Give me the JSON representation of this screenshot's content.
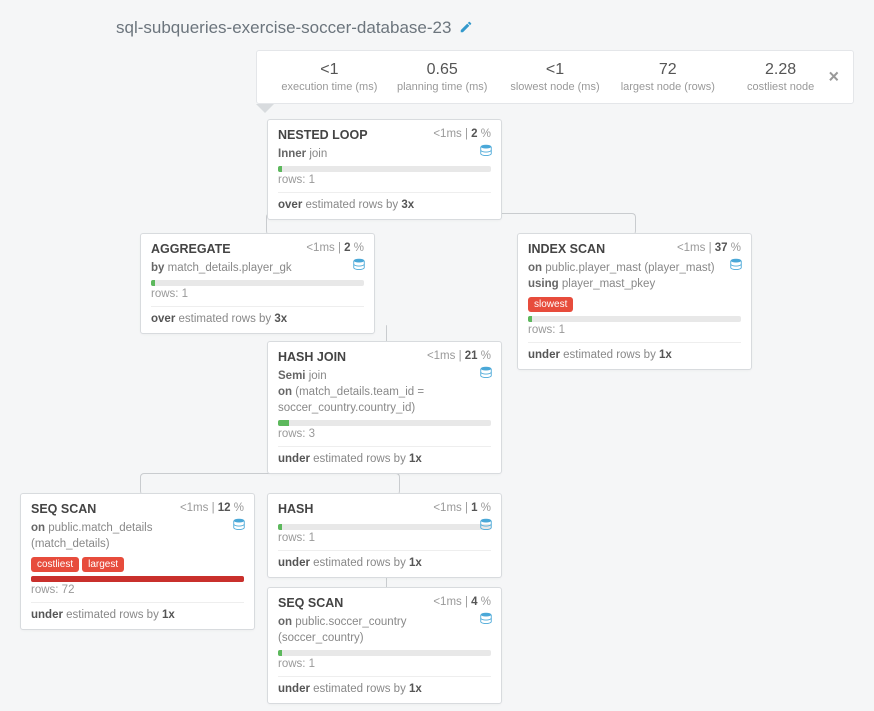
{
  "title": "sql-subqueries-exercise-soccer-database-23",
  "stats": {
    "exec_val": "<1",
    "exec_lbl": "execution time (ms)",
    "plan_val": "0.65",
    "plan_lbl": "planning time (ms)",
    "slow_val": "<1",
    "slow_lbl": "slowest node (ms)",
    "large_val": "72",
    "large_lbl": "largest node (rows)",
    "cost_val": "2.28",
    "cost_lbl": "costliest node"
  },
  "nodes": {
    "n0": {
      "title": "NESTED LOOP",
      "ms": "<1ms",
      "pct": "2",
      "desc_a": "Inner",
      "desc_b": " join",
      "bar_w": "2%",
      "bar_c": "bar-green",
      "rows": "1",
      "est_a": "over",
      "est_b": " estimated rows by ",
      "est_c": "3x"
    },
    "n1": {
      "title": "AGGREGATE",
      "ms": "<1ms",
      "pct": "2",
      "desc_a": "by",
      "desc_b": " match_details.player_gk",
      "bar_w": "2%",
      "bar_c": "bar-green",
      "rows": "1",
      "est_a": "over",
      "est_b": " estimated rows by ",
      "est_c": "3x"
    },
    "n2": {
      "title": "INDEX SCAN",
      "ms": "<1ms",
      "pct": "37",
      "desc_a": "on",
      "desc_b": " public.player_mast (player_mast)",
      "desc_c": "using",
      "desc_d": " player_mast_pkey",
      "badge1": "slowest",
      "bar_w": "2%",
      "bar_c": "bar-green",
      "rows": "1",
      "est_a": "under",
      "est_b": " estimated rows by ",
      "est_c": "1x"
    },
    "n3": {
      "title": "HASH JOIN",
      "ms": "<1ms",
      "pct": "21",
      "desc_a": "Semi",
      "desc_b": " join",
      "desc_c": "on",
      "desc_d": " (match_details.team_id = soccer_country.country_id)",
      "bar_w": "5%",
      "bar_c": "bar-green",
      "rows": "3",
      "est_a": "under",
      "est_b": " estimated rows by ",
      "est_c": "1x"
    },
    "n4": {
      "title": "SEQ SCAN",
      "ms": "<1ms",
      "pct": "12",
      "desc_a": "on",
      "desc_b": " public.match_details (match_details)",
      "badge1": "costliest",
      "badge2": "largest",
      "bar_w": "100%",
      "bar_c": "bar-red",
      "rows": "72",
      "est_a": "under",
      "est_b": " estimated rows by ",
      "est_c": "1x"
    },
    "n5": {
      "title": "HASH",
      "ms": "<1ms",
      "pct": "1",
      "bar_w": "2%",
      "bar_c": "bar-green",
      "rows": "1",
      "est_a": "under",
      "est_b": " estimated rows by ",
      "est_c": "1x"
    },
    "n6": {
      "title": "SEQ SCAN",
      "ms": "<1ms",
      "pct": "4",
      "desc_a": "on",
      "desc_b": " public.soccer_country (soccer_country)",
      "bar_w": "2%",
      "bar_c": "bar-green",
      "rows": "1",
      "est_a": "under",
      "est_b": " estimated rows by ",
      "est_c": "1x"
    }
  }
}
